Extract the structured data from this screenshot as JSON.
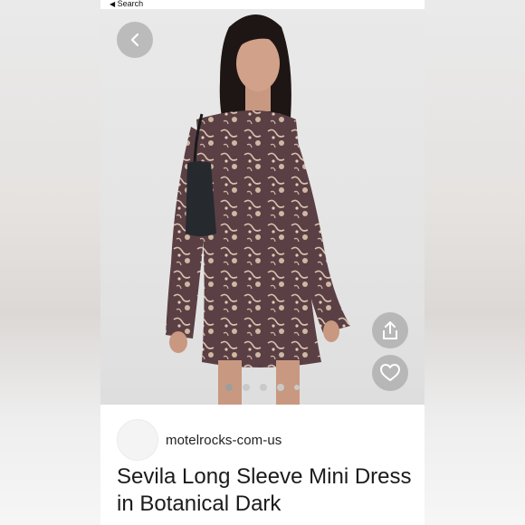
{
  "statusbar": {
    "back_label": "Search"
  },
  "carousel": {
    "total": 5,
    "active_index": 0
  },
  "seller": {
    "name": "motelrocks-com-us"
  },
  "listing": {
    "title": "Sevila Long Sleeve Mini Dress in Botanical Dark"
  },
  "colors": {
    "dress": "#5a3f44",
    "print": "#d8c2ad",
    "button_bg": "#969696"
  },
  "icons": {
    "back": "chevron-left-icon",
    "share": "share-icon",
    "like": "heart-icon"
  }
}
